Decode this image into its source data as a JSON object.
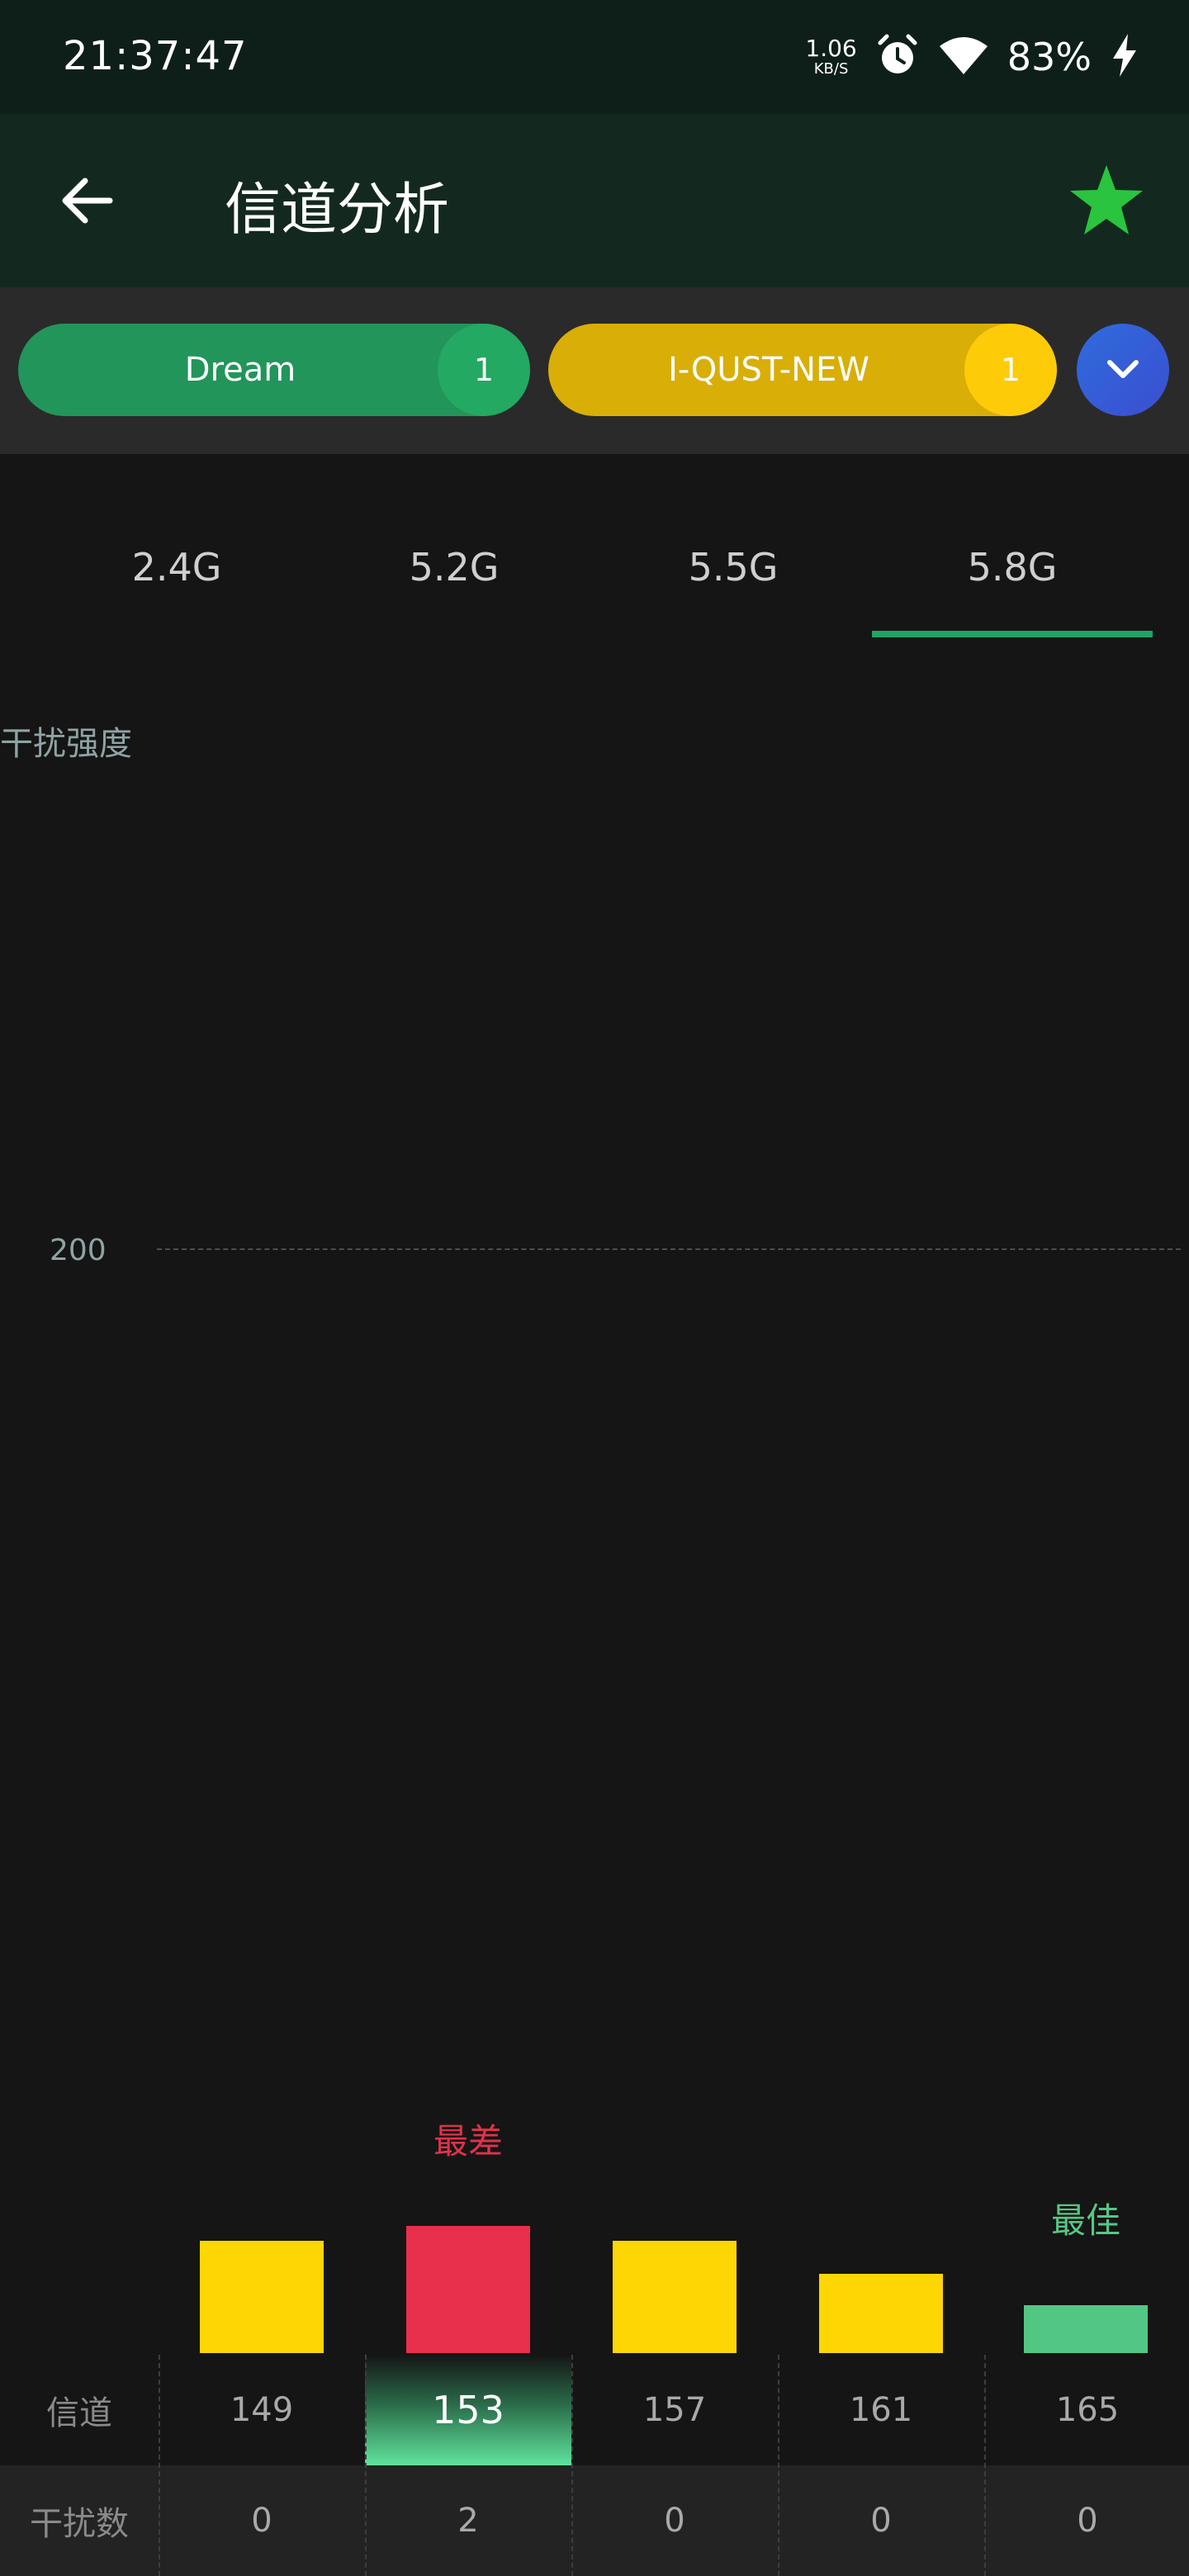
{
  "status": {
    "time": "21:37:47",
    "net_speed_value": "1.06",
    "net_speed_unit": "KB/S",
    "battery": "83%"
  },
  "app_bar": {
    "title": "信道分析"
  },
  "networks": [
    {
      "name": "Dream",
      "count": "1",
      "color": "#22955a"
    },
    {
      "name": "I-QUST-NEW",
      "count": "1",
      "color": "#d9ae07"
    }
  ],
  "bands": {
    "tabs": [
      "2.4G",
      "5.2G",
      "5.5G",
      "5.8G"
    ],
    "selected": "5.8G"
  },
  "chart_data": {
    "type": "bar",
    "ylabel": "干扰强度",
    "yticks": [
      "200"
    ],
    "categories": [
      "149",
      "153",
      "157",
      "161",
      "165"
    ],
    "bar_colors": [
      "#fed603",
      "#e82f4b",
      "#fed603",
      "#fed603",
      "#52c784"
    ],
    "worst_label": "最差",
    "best_label": "最佳",
    "worst_channel": "153",
    "best_channel": "165"
  },
  "table": {
    "channel_header": "信道",
    "interference_header": "干扰数",
    "channels": [
      "149",
      "153",
      "157",
      "161",
      "165"
    ],
    "interference_counts": [
      "0",
      "2",
      "0",
      "0",
      "0"
    ],
    "selected_channel": "153"
  }
}
